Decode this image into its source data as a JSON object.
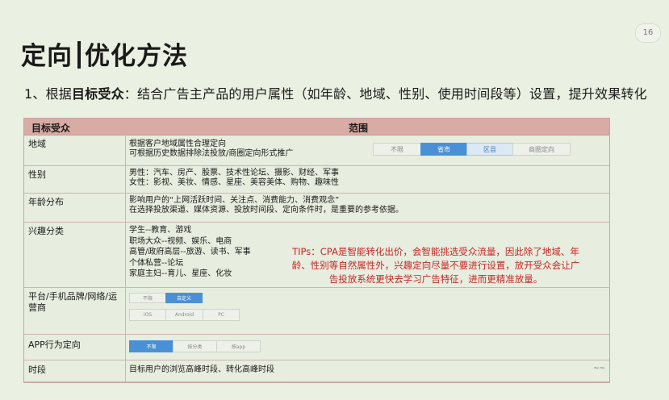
{
  "page_number": "16",
  "title": {
    "left": "定向",
    "right": "优化方法"
  },
  "subtitle": {
    "prefix": "1、根据",
    "bold": "目标受众",
    "suffix": "：结合广告主产品的用户属性（如年龄、地域、性别、使用时间段等）设置，提升效果转化"
  },
  "table": {
    "headers": [
      "目标受众",
      "范围"
    ],
    "rows": [
      {
        "name": "地域",
        "lines": [
          "根据客户地域属性合理定向",
          "可根据历史数据排除法投放/商圈定向形式推广"
        ],
        "options": [
          "不限",
          "省市",
          "区县",
          "商圈定向"
        ]
      },
      {
        "name": "性别",
        "lines": [
          "男性：汽车、房产、股票、技术性论坛、摄影、财经、军事",
          "女性：影视、美妆、情感、星座、美容美体、购物、趣味性"
        ]
      },
      {
        "name": "年龄分布",
        "lines": [
          "影响用户的“上网活跃时间、关注点、消费能力、消费观念”",
          "在选择投放渠道、媒体资源、投放时间段、定向条件时，是重要的参考依据。"
        ]
      },
      {
        "name": "兴趣分类",
        "lines": [
          "学生--教育、游戏",
          "职场大众--视频、娱乐、电商",
          "高管/政府高层--旅游、读书、军事",
          "个体私营--论坛",
          "家庭主妇--育儿、星座、化妆"
        ]
      },
      {
        "name": "平台/手机品牌/网络/运营商",
        "options_row1": [
          "不限",
          "自定义"
        ],
        "options_row2": [
          "iOS",
          "Android",
          "PC"
        ]
      },
      {
        "name": "APP行为定向",
        "options": [
          "不限",
          "按分类",
          "按app"
        ]
      },
      {
        "name": "时段",
        "lines": [
          "目标用户的浏览高峰时段、转化高峰时段"
        ],
        "tail": "~~"
      }
    ]
  },
  "tips": "TIPs：CPA是智能转化出价，会智能挑选受众流量，因此除了地域、年龄、性别等自然属性外，兴趣定向尽量不要进行设置，放开受众会让广告投放系统更快去学习广告特征，进而更精准放量。"
}
